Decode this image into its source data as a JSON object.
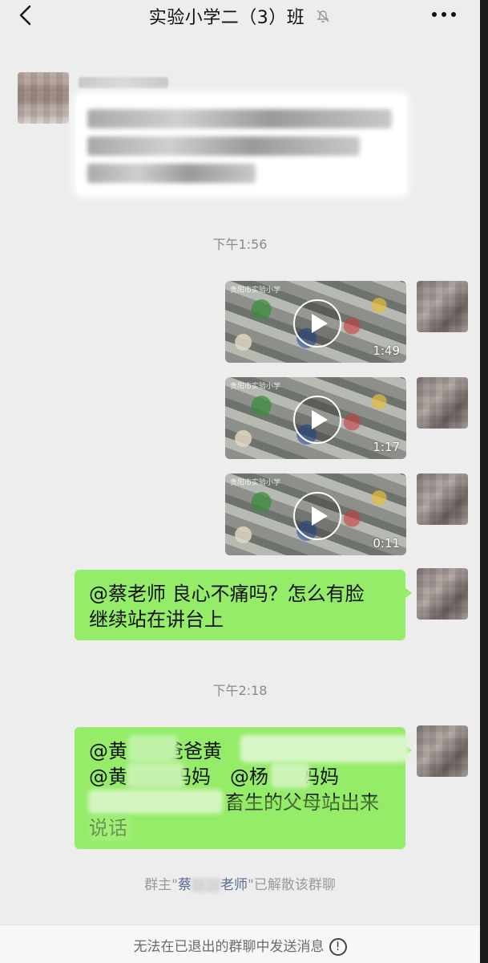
{
  "header": {
    "title": "实验小学二（3）班"
  },
  "timestamps": [
    "下午1:56",
    "下午2:18"
  ],
  "videos": [
    {
      "watermark": "贵阳市实验小学",
      "duration": "1:49"
    },
    {
      "watermark": "贵阳市实验小学",
      "duration": "1:17"
    },
    {
      "watermark": "贵阳市实验小学",
      "duration": "0:11"
    }
  ],
  "messages": {
    "m1": {
      "line1": "@蔡老师  良心不痛吗？怎么有脸",
      "line2": "继续站在讲台上"
    },
    "m2": {
      "line1": "@黄",
      "line1b": "爸爸黄",
      "line2": "@黄",
      "line2b": "妈妈",
      "line2c": "@杨",
      "line2d": "妈妈",
      "line3": "畜生的父母站出来",
      "line4": "说话"
    }
  },
  "system_notice": {
    "prefix": "群主\"",
    "name_start": "蔡",
    "name_end": "老师",
    "suffix": "\"已解散该群聊"
  },
  "bottom_bar": {
    "text": "无法在已退出的群聊中发送消息",
    "icon_glyph": "!"
  },
  "colors": {
    "chat_bg": "#ededed",
    "bubble_green": "#95ec69",
    "link_blue": "#576b95"
  }
}
